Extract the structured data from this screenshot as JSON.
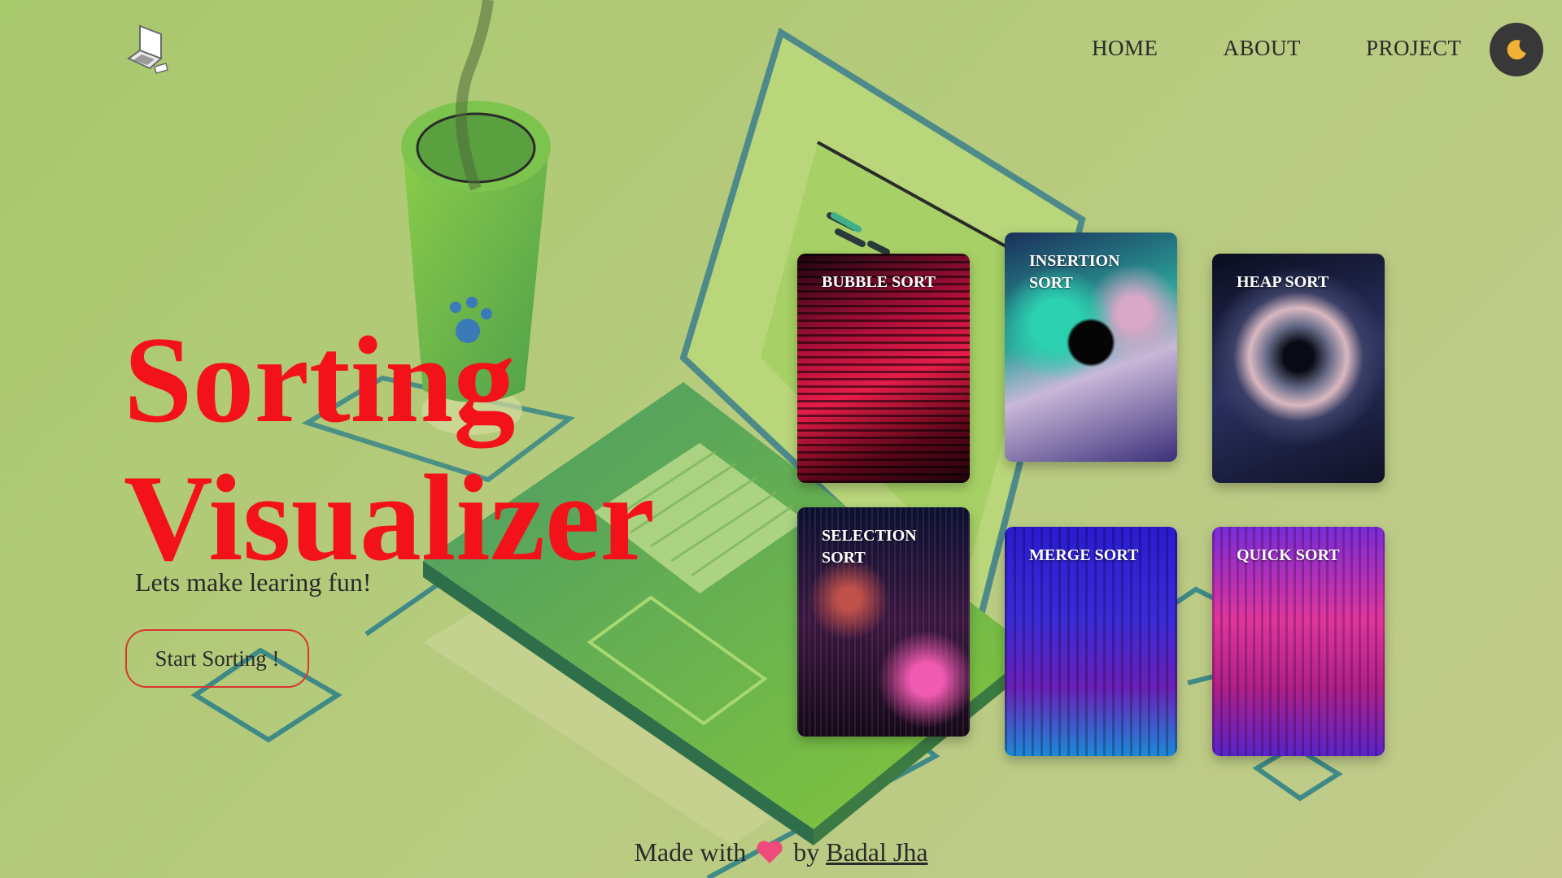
{
  "header": {
    "logo_icon": "laptop-icon",
    "nav": [
      "HOME",
      "ABOUT",
      "PROJECT"
    ],
    "theme_toggle_icon": "moon-icon"
  },
  "hero": {
    "title_line1": "Sorting",
    "title_line2": "Visualizer",
    "tagline": "Lets make learing fun!",
    "cta": "Start Sorting !",
    "title_color": "#f4121a"
  },
  "cards": [
    {
      "label": "BUBBLE SORT"
    },
    {
      "label": "INSERTION SORT"
    },
    {
      "label": "HEAP SORT"
    },
    {
      "label": "SELECTION SORT"
    },
    {
      "label": "MERGE SORT"
    },
    {
      "label": "QUICK SORT"
    }
  ],
  "footer": {
    "made_with": "Made with",
    "heart_icon": "heart-icon",
    "by": "by",
    "author": "Badal Jha"
  },
  "colors": {
    "background": "#b6cb7d",
    "accent_red": "#f4121a",
    "laptop_green": "#6cbf3a",
    "theme_button": "#383838"
  }
}
